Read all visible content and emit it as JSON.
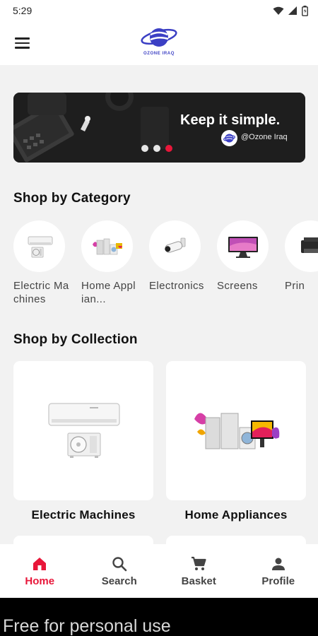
{
  "status_bar": {
    "time": "5:29"
  },
  "app_bar": {
    "logo_text": "OZONE IRAQ"
  },
  "banner": {
    "headline": "Keep it simple.",
    "handle": "@Ozone Iraq",
    "slide_count": 3,
    "active_slide": 3
  },
  "categories": {
    "title": "Shop by Category",
    "items": [
      {
        "label": "Electric Machines",
        "icon": "air-conditioner-icon"
      },
      {
        "label": "Home Applian...",
        "icon": "home-appliances-icon"
      },
      {
        "label": "Electronics",
        "icon": "security-camera-icon"
      },
      {
        "label": "Screens",
        "icon": "monitor-icon"
      },
      {
        "label": "Prin",
        "icon": "printer-icon"
      }
    ]
  },
  "collections": {
    "title": "Shop by Collection",
    "items": [
      {
        "label": "Electric Machines",
        "icon": "air-conditioner-icon"
      },
      {
        "label": "Home Appliances",
        "icon": "home-appliances-icon"
      }
    ]
  },
  "bottom_nav": {
    "items": [
      {
        "label": "Home",
        "icon": "home-icon",
        "active": true
      },
      {
        "label": "Search",
        "icon": "search-icon",
        "active": false
      },
      {
        "label": "Basket",
        "icon": "cart-icon",
        "active": false
      },
      {
        "label": "Profile",
        "icon": "person-icon",
        "active": false
      }
    ]
  },
  "watermark": {
    "text": "Free for personal use"
  },
  "colors": {
    "accent": "#e8173a",
    "brand_blue": "#3b3fc4",
    "background": "#f2f2f2"
  }
}
